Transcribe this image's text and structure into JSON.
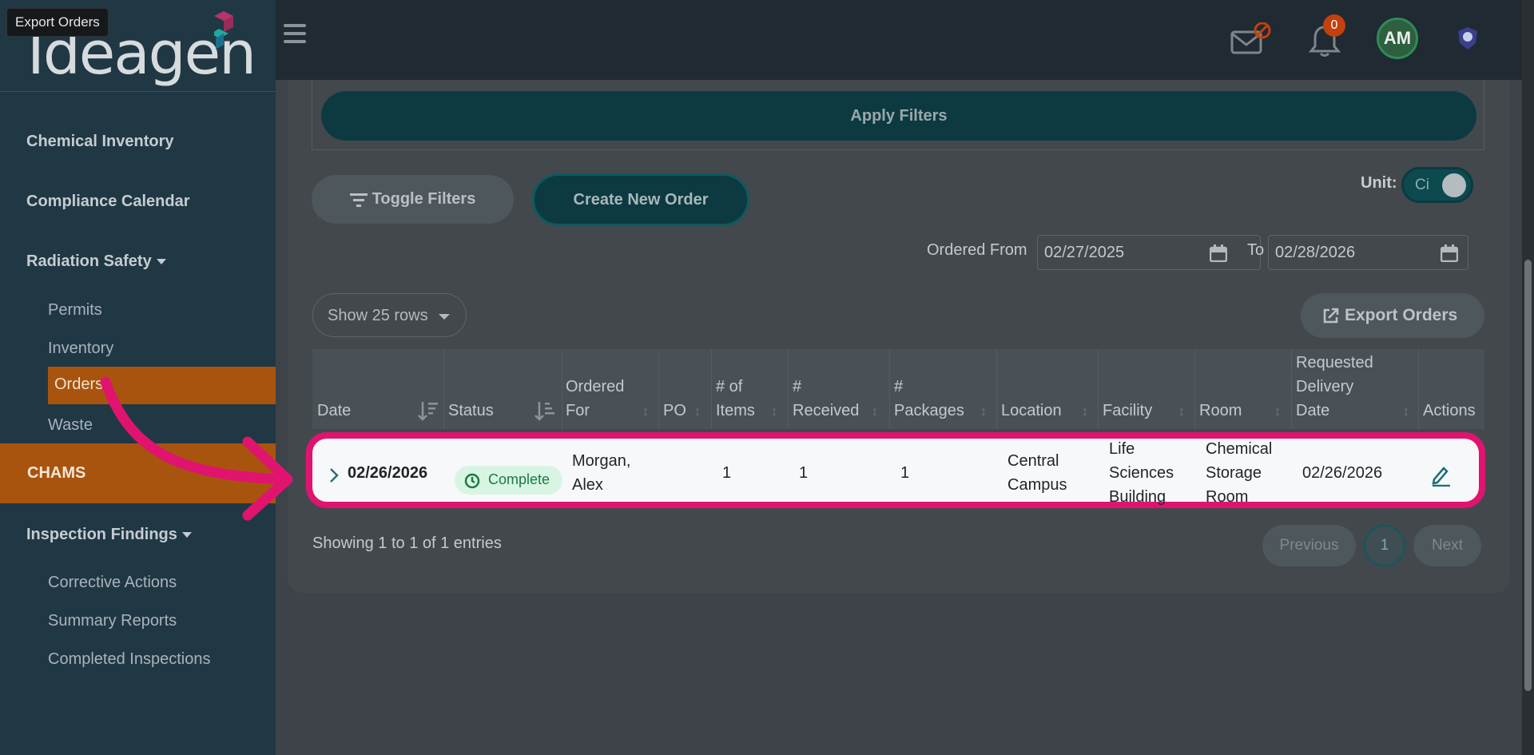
{
  "tooltip": "Export Orders",
  "brand": {
    "logo_text": "Ideagen"
  },
  "sidebar": {
    "chemical_inventory": "Chemical Inventory",
    "compliance_calendar": "Compliance Calendar",
    "radiation_safety": "Radiation Safety",
    "permits": "Permits",
    "inventory": "Inventory",
    "orders": "Orders",
    "waste": "Waste",
    "chams": "CHAMS",
    "inspection_findings": "Inspection Findings",
    "corrective_actions": "Corrective Actions",
    "summary_reports": "Summary Reports",
    "completed_inspections": "Completed Inspections"
  },
  "header": {
    "notification_count": "0",
    "avatar_initials": "AM"
  },
  "filters": {
    "apply_label": "Apply Filters",
    "toggle_label": "Toggle Filters",
    "create_label": "Create New Order",
    "unit_label": "Unit:",
    "unit_value": "Ci",
    "ordered_from_label": "Ordered From",
    "from_date": "02/27/2025",
    "to_label": "To",
    "to_date": "02/28/2026"
  },
  "table_controls": {
    "show_rows": "Show 25 rows",
    "export_label": "Export Orders"
  },
  "table": {
    "headers": {
      "date": "Date",
      "status": "Status",
      "ordered_for_1": "Ordered",
      "ordered_for_2": "For",
      "po": "PO",
      "items_1": "# of",
      "items_2": "Items",
      "received_1": "#",
      "received_2": "Received",
      "packages_1": "#",
      "packages_2": "Packages",
      "location": "Location",
      "facility": "Facility",
      "room": "Room",
      "rdd_1": "Requested",
      "rdd_2": "Delivery",
      "rdd_3": "Date",
      "actions": "Actions"
    },
    "rows": [
      {
        "date": "02/26/2026",
        "status": "Complete",
        "ordered_for_1": "Morgan,",
        "ordered_for_2": "Alex",
        "po": "",
        "items": "1",
        "received": "1",
        "packages": "1",
        "location_1": "Central",
        "location_2": "Campus",
        "facility_1": "Life",
        "facility_2": "Sciences",
        "facility_3": "Building",
        "room_1": "Chemical",
        "room_2": "Storage",
        "room_3": "Room",
        "requested_delivery": "02/26/2026"
      }
    ]
  },
  "pagination": {
    "showing": "Showing 1 to 1 of 1 entries",
    "previous": "Previous",
    "current": "1",
    "next": "Next"
  },
  "colors": {
    "highlight": "#e0146e",
    "teal": "#0c3a40",
    "orange": "#a8540f"
  }
}
